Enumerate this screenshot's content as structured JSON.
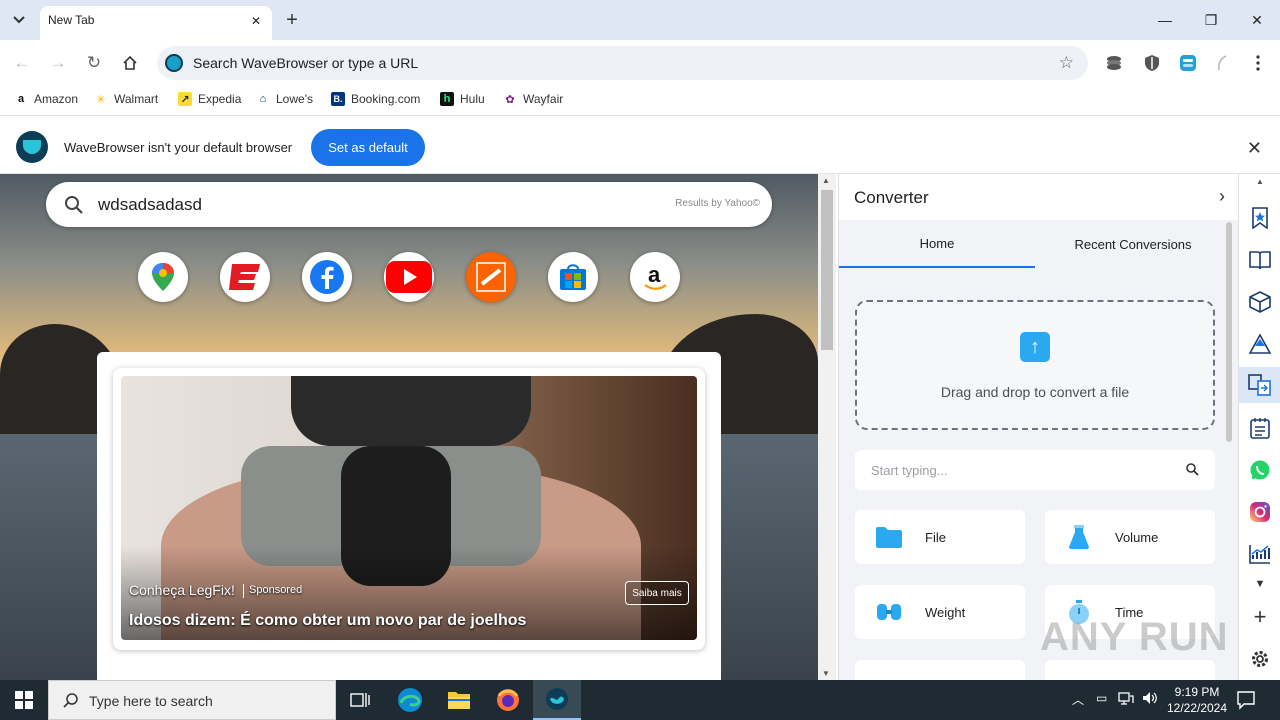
{
  "browser": {
    "tab": {
      "title": "New Tab"
    },
    "omnibox": {
      "placeholder": "Search WaveBrowser or type a URL"
    },
    "bookmarks": [
      {
        "label": "Amazon",
        "icon": "amazon-icon",
        "glyph": "a",
        "color": "#111111"
      },
      {
        "label": "Walmart",
        "icon": "walmart-icon",
        "glyph": "✳",
        "color": "#f4b400"
      },
      {
        "label": "Expedia",
        "icon": "expedia-icon",
        "glyph": "↗",
        "color": "#1b2a52"
      },
      {
        "label": "Lowe's",
        "icon": "lowes-icon",
        "glyph": "⌂",
        "color": "#012169"
      },
      {
        "label": "Booking.com",
        "icon": "booking-icon",
        "glyph": "B.",
        "color": "#003580"
      },
      {
        "label": "Hulu",
        "icon": "hulu-icon",
        "glyph": "h",
        "color": "#1ce783"
      },
      {
        "label": "Wayfair",
        "icon": "wayfair-icon",
        "glyph": "✿",
        "color": "#7f187f"
      }
    ]
  },
  "infobar": {
    "message": "WaveBrowser isn't your default browser",
    "button": "Set as default"
  },
  "newtab": {
    "search": {
      "value": "wdsadsadasd",
      "provider": "Results by Yahoo©"
    },
    "shortcuts": [
      {
        "name": "google-maps-icon"
      },
      {
        "name": "espn-icon"
      },
      {
        "name": "facebook-icon"
      },
      {
        "name": "youtube-icon"
      },
      {
        "name": "home-depot-icon"
      },
      {
        "name": "microsoft-store-icon"
      },
      {
        "name": "amazon-icon"
      }
    ],
    "ad": {
      "brand": "Conheça LegFix!",
      "sponsored": "Sponsored",
      "headline": "Idosos dizem: É como obter um novo par de joelhos",
      "cta": "Saiba mais"
    }
  },
  "converter": {
    "title": "Converter",
    "tabs": [
      "Home",
      "Recent Conversions"
    ],
    "active_tab": "Home",
    "dropzone": "Drag and drop to convert a file",
    "search_placeholder": "Start typing...",
    "categories": [
      {
        "label": "File",
        "icon": "folder-icon"
      },
      {
        "label": "Volume",
        "icon": "flask-icon"
      },
      {
        "label": "Weight",
        "icon": "dumbbell-icon"
      },
      {
        "label": "Time",
        "icon": "stopwatch-icon"
      }
    ]
  },
  "watermark": "ANY RUN",
  "taskbar": {
    "search_placeholder": "Type here to search",
    "time": "9:19 PM",
    "date": "12/22/2024"
  },
  "colors": {
    "accent": "#1a73e8",
    "tabstrip": "#dfe7f5",
    "taskbar": "#1f2b33"
  }
}
